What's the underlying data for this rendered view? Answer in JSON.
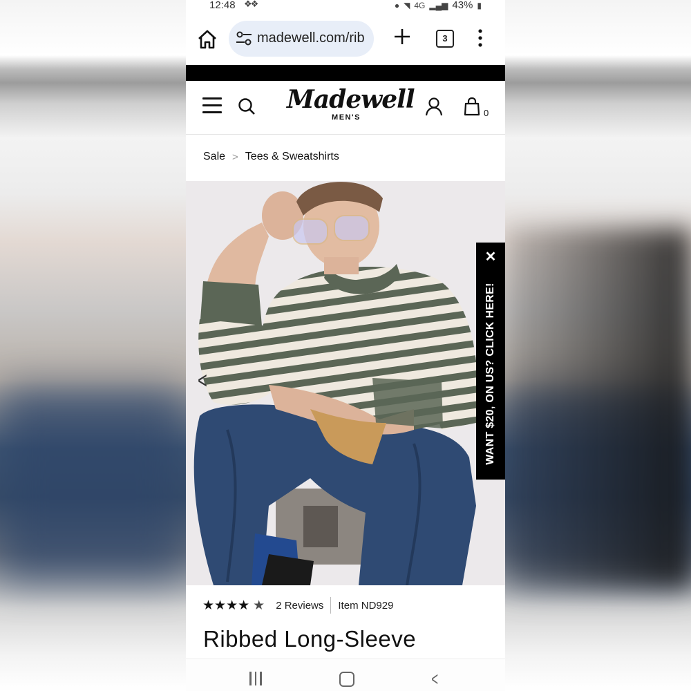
{
  "status_bar": {
    "time": "12:48",
    "notification_icons": "dropbox-icon",
    "battery": "43%",
    "network": "4G"
  },
  "browser": {
    "url": "madewell.com/rib",
    "tab_count": "3"
  },
  "site": {
    "logo_word": "Madewell",
    "logo_sub": "MEN'S",
    "bag_count": "0"
  },
  "breadcrumb": {
    "items": [
      "Sale",
      "Tees & Sweatshirts"
    ],
    "separator": ">"
  },
  "promo": {
    "close": "✕",
    "text": "WANT $20, ON US? CLICK HERE!"
  },
  "product": {
    "rating": 4.5,
    "stars": "★★★★",
    "half_star": "★",
    "reviews": "2 Reviews",
    "item": "Item ND929",
    "title": "Ribbed Long-Sleeve"
  },
  "colors": {
    "brand_black": "#000000",
    "url_pill": "#e8eef8",
    "stripe_green": "#5b6656",
    "stripe_cream": "#efe9df",
    "denim": "#2f4a73"
  }
}
